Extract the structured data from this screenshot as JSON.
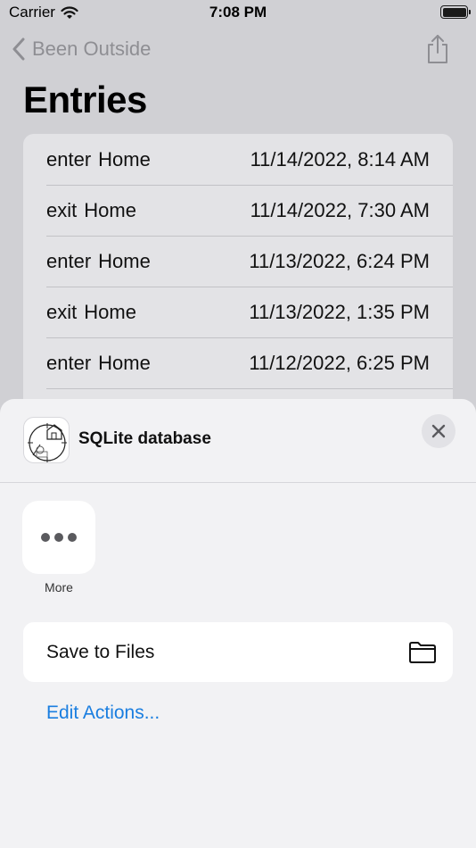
{
  "status_bar": {
    "carrier": "Carrier",
    "time": "7:08 PM"
  },
  "nav": {
    "back_label": "Been Outside",
    "title": "Entries"
  },
  "entries": [
    {
      "event": "enter",
      "place": "Home",
      "date": "11/14/2022, 8:14 AM"
    },
    {
      "event": "exit",
      "place": "Home",
      "date": "11/14/2022, 7:30 AM"
    },
    {
      "event": "enter",
      "place": "Home",
      "date": "11/13/2022, 6:24 PM"
    },
    {
      "event": "exit",
      "place": "Home",
      "date": "11/13/2022, 1:35 PM"
    },
    {
      "event": "enter",
      "place": "Home",
      "date": "11/12/2022, 6:25 PM"
    }
  ],
  "share_sheet": {
    "title": "SQLite database",
    "more_label": "More",
    "save_label": "Save to Files",
    "edit_actions_label": "Edit Actions..."
  },
  "colors": {
    "accent": "#1a7ee0",
    "sheet_bg": "#f2f2f4",
    "dim_bg": "#d0d0d4"
  },
  "icons": [
    "wifi-icon",
    "battery-icon",
    "back-chevron-icon",
    "share-icon",
    "app-icon",
    "close-icon",
    "more-icon",
    "folder-icon"
  ]
}
